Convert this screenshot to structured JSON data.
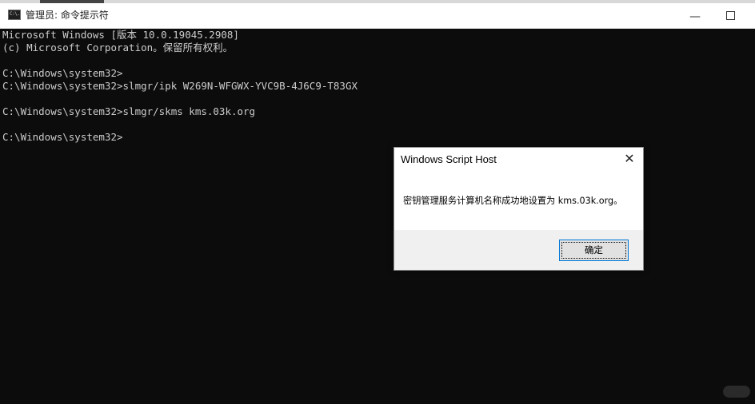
{
  "window": {
    "title": "管理员: 命令提示符",
    "minimize_glyph": "—",
    "maximize_glyph": "",
    "icon_text": "C:\\."
  },
  "console": {
    "lines": [
      "Microsoft Windows [版本 10.0.19045.2908]",
      "(c) Microsoft Corporation。保留所有权利。",
      "",
      "C:\\Windows\\system32>",
      "C:\\Windows\\system32>slmgr/ipk W269N-WFGWX-YVC9B-4J6C9-T83GX",
      "",
      "C:\\Windows\\system32>slmgr/skms kms.03k.org",
      "",
      "C:\\Windows\\system32>"
    ]
  },
  "dialog": {
    "title": "Windows Script Host",
    "close_glyph": "✕",
    "message": "密钥管理服务计算机名称成功地设置为 kms.03k.org。",
    "ok_label": "确定"
  },
  "colors": {
    "console_bg": "#0c0c0c",
    "console_fg": "#cccccc",
    "titlebar_bg": "#ffffff",
    "dialog_footer_bg": "#f0f0f0",
    "accent": "#0078d7"
  },
  "icons": {
    "window_icon": "cmd-icon",
    "dialog_close": "close-icon",
    "minimize": "minimize-icon",
    "maximize": "maximize-icon"
  }
}
